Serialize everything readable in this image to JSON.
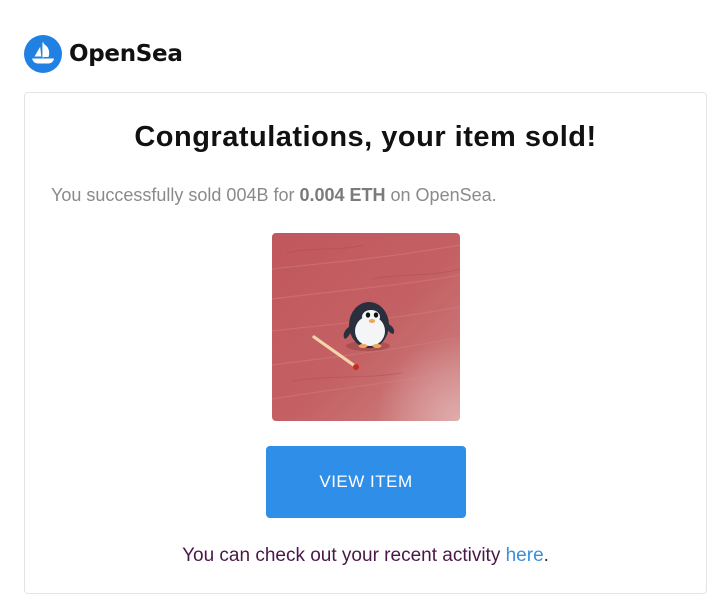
{
  "header": {
    "brand": "OpenSea",
    "logo_icon": "opensea-ship-icon"
  },
  "email": {
    "title": "Congratulations, your item sold!",
    "message_prefix": "You successfully sold 004B for ",
    "price": "0.004 ETH",
    "message_suffix": " on OpenSea.",
    "item_image": "penguin-nft-image",
    "button_label": "VIEW ITEM",
    "activity_prefix": "You can check out your recent activity ",
    "activity_link": "here",
    "activity_suffix": "."
  },
  "colors": {
    "accent": "#2f8ee8",
    "brand_blue": "#2081e2",
    "link": "#3b8fdc",
    "footer_text": "#4a1848"
  }
}
